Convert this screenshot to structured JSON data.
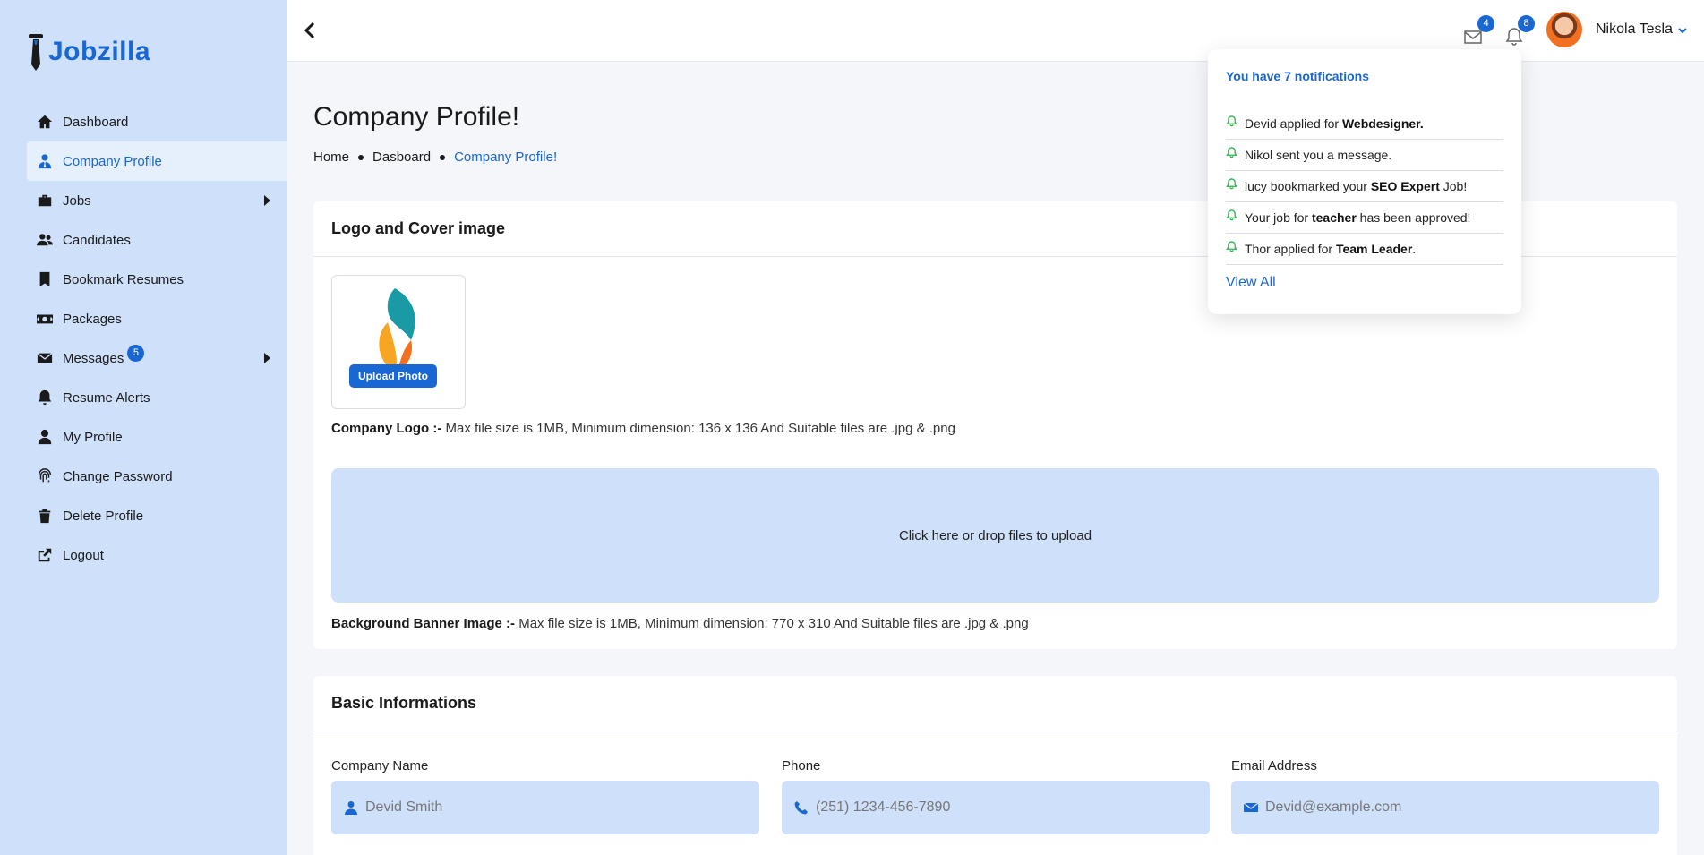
{
  "brand": {
    "name": "Jobzilla"
  },
  "sidebar": {
    "items": [
      {
        "label": "Dashboard",
        "icon": "home-icon"
      },
      {
        "label": "Company Profile",
        "icon": "user-tie-icon",
        "active": true
      },
      {
        "label": "Jobs",
        "icon": "briefcase-icon",
        "has_submenu": true
      },
      {
        "label": "Candidates",
        "icon": "users-icon"
      },
      {
        "label": "Bookmark Resumes",
        "icon": "bookmark-icon"
      },
      {
        "label": "Packages",
        "icon": "money-icon"
      },
      {
        "label": "Messages",
        "icon": "envelope-icon",
        "badge": "5",
        "has_submenu": true
      },
      {
        "label": "Resume Alerts",
        "icon": "bell-icon"
      },
      {
        "label": "My Profile",
        "icon": "user-icon"
      },
      {
        "label": "Change Password",
        "icon": "fingerprint-icon"
      },
      {
        "label": "Delete Profile",
        "icon": "trash-icon"
      },
      {
        "label": "Logout",
        "icon": "logout-icon"
      }
    ]
  },
  "header": {
    "messages_badge": "4",
    "notifications_badge": "8",
    "user_name": "Nikola Tesla"
  },
  "page": {
    "title": "Company Profile!",
    "breadcrumb": [
      "Home",
      "Dasboard",
      "Company Profile!"
    ]
  },
  "logo_section": {
    "title": "Logo and Cover image",
    "upload_button": "Upload Photo",
    "logo_hint_label": "Company Logo :-",
    "logo_hint_text": " Max file size is 1MB, Minimum dimension: 136 x 136 And Suitable files are .jpg & .png",
    "dropzone_text": "Click here or drop files to upload",
    "banner_hint_label": "Background Banner Image :-",
    "banner_hint_text": " Max file size is 1MB, Minimum dimension: 770 x 310 And Suitable files are .jpg & .png"
  },
  "basic_info": {
    "title": "Basic Informations",
    "fields": [
      {
        "label": "Company Name",
        "placeholder": "Devid Smith",
        "icon": "user-icon"
      },
      {
        "label": "Phone",
        "placeholder": "(251) 1234-456-7890",
        "icon": "phone-icon"
      },
      {
        "label": "Email Address",
        "placeholder": "Devid@example.com",
        "icon": "envelope-icon"
      }
    ]
  },
  "notifications": {
    "title": "You have 7 notifications",
    "items": [
      {
        "pre": "Devid applied for ",
        "bold": "Webdesigner.",
        "post": ""
      },
      {
        "pre": "Nikol sent you a message.",
        "bold": "",
        "post": ""
      },
      {
        "pre": "lucy bookmarked your ",
        "bold": "SEO Expert",
        "post": " Job!"
      },
      {
        "pre": "Your job for ",
        "bold": "teacher",
        "post": " has been approved!"
      },
      {
        "pre": "Thor applied for ",
        "bold": "Team Leader",
        "post": "."
      }
    ],
    "view_all": "View All"
  },
  "colors": {
    "accent": "#1967d2",
    "sidebar_bg": "#cfe0fb",
    "bell_green": "#2bb24c"
  }
}
